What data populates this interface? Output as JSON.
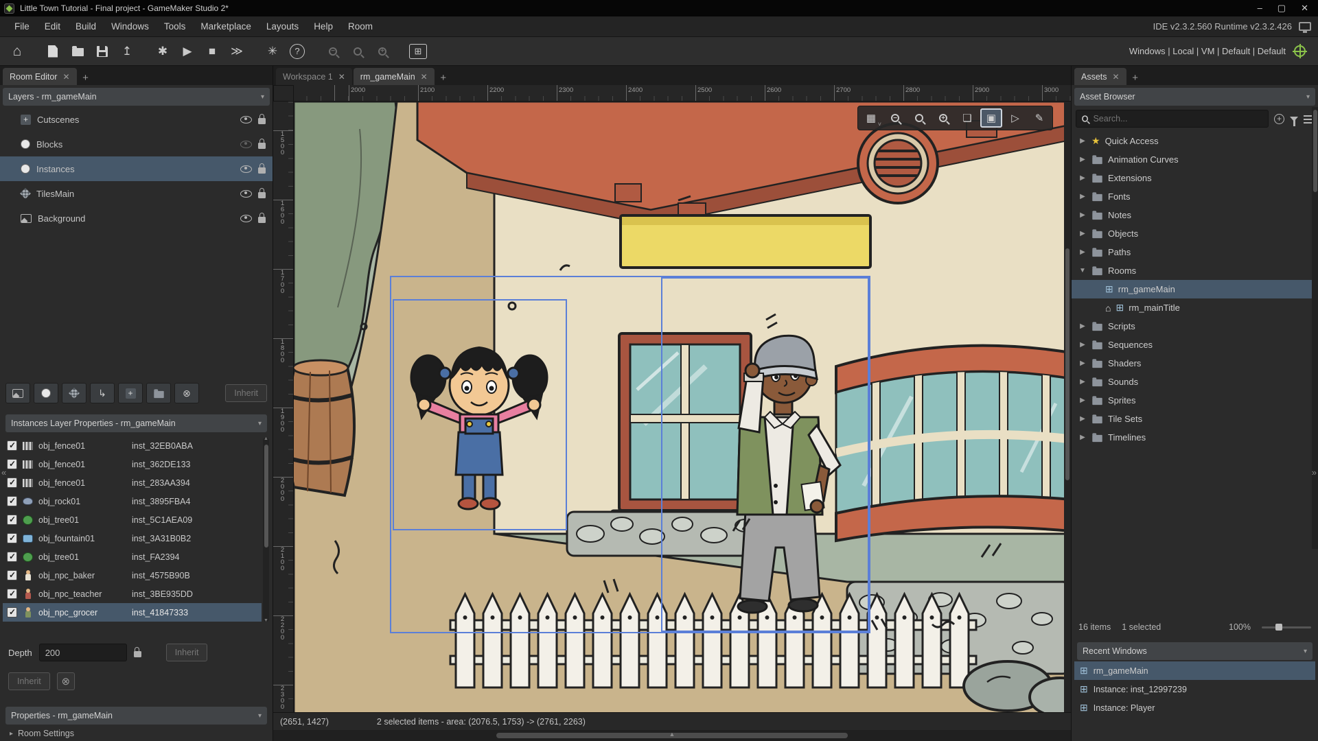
{
  "window": {
    "title": "Little Town Tutorial - Final project - GameMaker Studio 2*"
  },
  "menu": {
    "items": [
      "File",
      "Edit",
      "Build",
      "Windows",
      "Tools",
      "Marketplace",
      "Layouts",
      "Help",
      "Room"
    ],
    "ide_version": "IDE v2.3.2.560 Runtime v2.3.2.426"
  },
  "toolbar": {
    "targets": "Windows | Local | VM | Default | Default"
  },
  "left_panel": {
    "tab": "Room Editor",
    "layers_header": "Layers - rm_gameMain",
    "layers": [
      {
        "name": "Cutscenes",
        "icon": "asset",
        "visible": true,
        "selected": false
      },
      {
        "name": "Blocks",
        "icon": "instance",
        "visible": false,
        "selected": false
      },
      {
        "name": "Instances",
        "icon": "instance",
        "visible": true,
        "selected": true
      },
      {
        "name": "TilesMain",
        "icon": "tile",
        "visible": true,
        "selected": false
      },
      {
        "name": "Background",
        "icon": "background",
        "visible": true,
        "selected": false
      }
    ],
    "layer_toolbar_inherit": "Inherit",
    "instances_header": "Instances Layer Properties - rm_gameMain",
    "instances": [
      {
        "icon": "fence",
        "obj": "obj_fence01",
        "inst": "inst_32EB0ABA",
        "selected": false
      },
      {
        "icon": "fence",
        "obj": "obj_fence01",
        "inst": "inst_362DE133",
        "selected": false
      },
      {
        "icon": "fence",
        "obj": "obj_fence01",
        "inst": "inst_283AA394",
        "selected": false
      },
      {
        "icon": "rock",
        "obj": "obj_rock01",
        "inst": "inst_3895FBA4",
        "selected": false
      },
      {
        "icon": "tree",
        "obj": "obj_tree01",
        "inst": "inst_5C1AEA09",
        "selected": false
      },
      {
        "icon": "fountain",
        "obj": "obj_fountain01",
        "inst": "inst_3A31B0B2",
        "selected": false
      },
      {
        "icon": "tree",
        "obj": "obj_tree01",
        "inst": "inst_FA2394",
        "selected": false
      },
      {
        "icon": "npc-baker",
        "obj": "obj_npc_baker",
        "inst": "inst_4575B90B",
        "selected": false
      },
      {
        "icon": "npc-teacher",
        "obj": "obj_npc_teacher",
        "inst": "inst_3BE935DD",
        "selected": false
      },
      {
        "icon": "npc-grocer",
        "obj": "obj_npc_grocer",
        "inst": "inst_41847333",
        "selected": true
      }
    ],
    "depth": {
      "label": "Depth",
      "value": "200",
      "inherit": "Inherit"
    },
    "inherit_button": "Inherit",
    "properties_header": "Properties - rm_gameMain",
    "room_settings_label": "Room Settings"
  },
  "workspace": {
    "tabs": [
      {
        "label": "Workspace 1",
        "active": false
      },
      {
        "label": "rm_gameMain",
        "active": true
      }
    ],
    "ruler_x": [
      "2000",
      "2100",
      "2200",
      "2300",
      "2400",
      "2500",
      "2600",
      "2700",
      "2800",
      "2900",
      "3000"
    ],
    "ruler_y": [
      "1500",
      "1600",
      "1700",
      "1800",
      "1900",
      "2000",
      "2100",
      "2200",
      "2300"
    ],
    "canvas_toolbar": [
      {
        "icon": "grid",
        "name": "grid-options-button",
        "active": false
      },
      {
        "icon": "zoom-out",
        "name": "zoom-out-button",
        "active": false
      },
      {
        "icon": "zoom-actual",
        "name": "zoom-actual-button",
        "active": false
      },
      {
        "icon": "zoom-in",
        "name": "zoom-in-button",
        "active": false
      },
      {
        "icon": "fit",
        "name": "fit-view-button",
        "active": false
      },
      {
        "icon": "region",
        "name": "region-select-button",
        "active": true
      },
      {
        "icon": "play",
        "name": "preview-button",
        "active": false
      },
      {
        "icon": "brush",
        "name": "paint-mode-button",
        "active": false
      }
    ],
    "status": {
      "coords": "(2651, 1427)",
      "selection": "2 selected items - area: (2076.5, 1753) -> (2761, 2263)"
    }
  },
  "assets_panel": {
    "tab": "Assets",
    "browser_header": "Asset Browser",
    "search_placeholder": "Search...",
    "tree": [
      {
        "label": "Quick Access",
        "icon": "star",
        "arrow": "right",
        "indent": 0,
        "selected": false,
        "home": false
      },
      {
        "label": "Animation Curves",
        "icon": "folder",
        "arrow": "right",
        "indent": 0,
        "selected": false,
        "home": false
      },
      {
        "label": "Extensions",
        "icon": "folder",
        "arrow": "right",
        "indent": 0,
        "selected": false,
        "home": false
      },
      {
        "label": "Fonts",
        "icon": "folder",
        "arrow": "right",
        "indent": 0,
        "selected": false,
        "home": false
      },
      {
        "label": "Notes",
        "icon": "folder",
        "arrow": "right",
        "indent": 0,
        "selected": false,
        "home": false
      },
      {
        "label": "Objects",
        "icon": "folder",
        "arrow": "right",
        "indent": 0,
        "selected": false,
        "home": false
      },
      {
        "label": "Paths",
        "icon": "folder",
        "arrow": "right",
        "indent": 0,
        "selected": false,
        "home": false
      },
      {
        "label": "Rooms",
        "icon": "folder",
        "arrow": "down",
        "indent": 0,
        "selected": false,
        "home": false
      },
      {
        "label": "rm_gameMain",
        "icon": "room",
        "arrow": "none",
        "indent": 1,
        "selected": true,
        "home": false
      },
      {
        "label": "rm_mainTitle",
        "icon": "room",
        "arrow": "none",
        "indent": 1,
        "selected": false,
        "home": true
      },
      {
        "label": "Scripts",
        "icon": "folder",
        "arrow": "right",
        "indent": 0,
        "selected": false,
        "home": false
      },
      {
        "label": "Sequences",
        "icon": "folder",
        "arrow": "right",
        "indent": 0,
        "selected": false,
        "home": false
      },
      {
        "label": "Shaders",
        "icon": "folder",
        "arrow": "right",
        "indent": 0,
        "selected": false,
        "home": false
      },
      {
        "label": "Sounds",
        "icon": "folder",
        "arrow": "right",
        "indent": 0,
        "selected": false,
        "home": false
      },
      {
        "label": "Sprites",
        "icon": "folder",
        "arrow": "right",
        "indent": 0,
        "selected": false,
        "home": false
      },
      {
        "label": "Tile Sets",
        "icon": "folder",
        "arrow": "right",
        "indent": 0,
        "selected": false,
        "home": false
      },
      {
        "label": "Timelines",
        "icon": "folder",
        "arrow": "right",
        "indent": 0,
        "selected": false,
        "home": false
      }
    ],
    "footer": {
      "items": "16 items",
      "selected": "1 selected",
      "zoom": "100%"
    },
    "recent_header": "Recent Windows",
    "recent": [
      {
        "label": "rm_gameMain",
        "selected": true
      },
      {
        "label": "Instance: inst_12997239",
        "selected": false
      },
      {
        "label": "Instance: Player",
        "selected": false
      }
    ]
  },
  "colors": {
    "selection_row": "#46586a",
    "canvas_selection": "#5b7fd8",
    "sage_ground": "#a8b6a4",
    "path_tan": "#c9b48c",
    "roof_terracotta": "#c4674a",
    "sign_yellow": "#ecd966",
    "glass_teal": "#8fc0bd",
    "vest_green": "#7f925e"
  }
}
